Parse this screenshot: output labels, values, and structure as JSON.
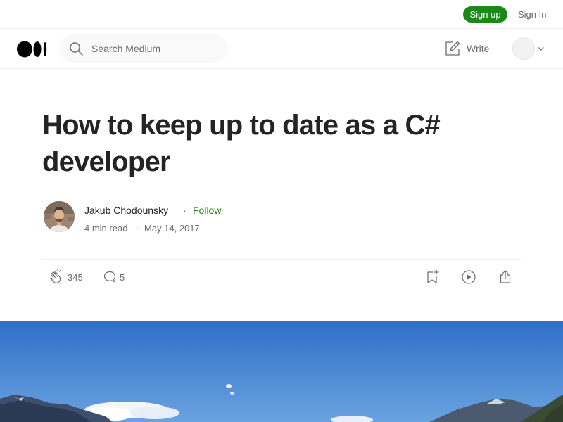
{
  "topbar": {
    "signup_label": "Sign up",
    "signin_label": "Sign In"
  },
  "nav": {
    "logo_icon": "medium-logo-icon",
    "search_placeholder": "Search Medium",
    "write_label": "Write"
  },
  "article": {
    "title": "How to keep up to date as a C# developer",
    "author_name": "Jakub Chodounsky",
    "separator": "·",
    "follow_label": "Follow",
    "read_time": "4 min read",
    "date": "May 14, 2017"
  },
  "actions": {
    "claps": "345",
    "responses": "5"
  },
  "colors": {
    "brand_green": "#1a8917",
    "text_primary": "#242424",
    "text_secondary": "#6b6b6b",
    "sky": "#3b7fd4"
  }
}
